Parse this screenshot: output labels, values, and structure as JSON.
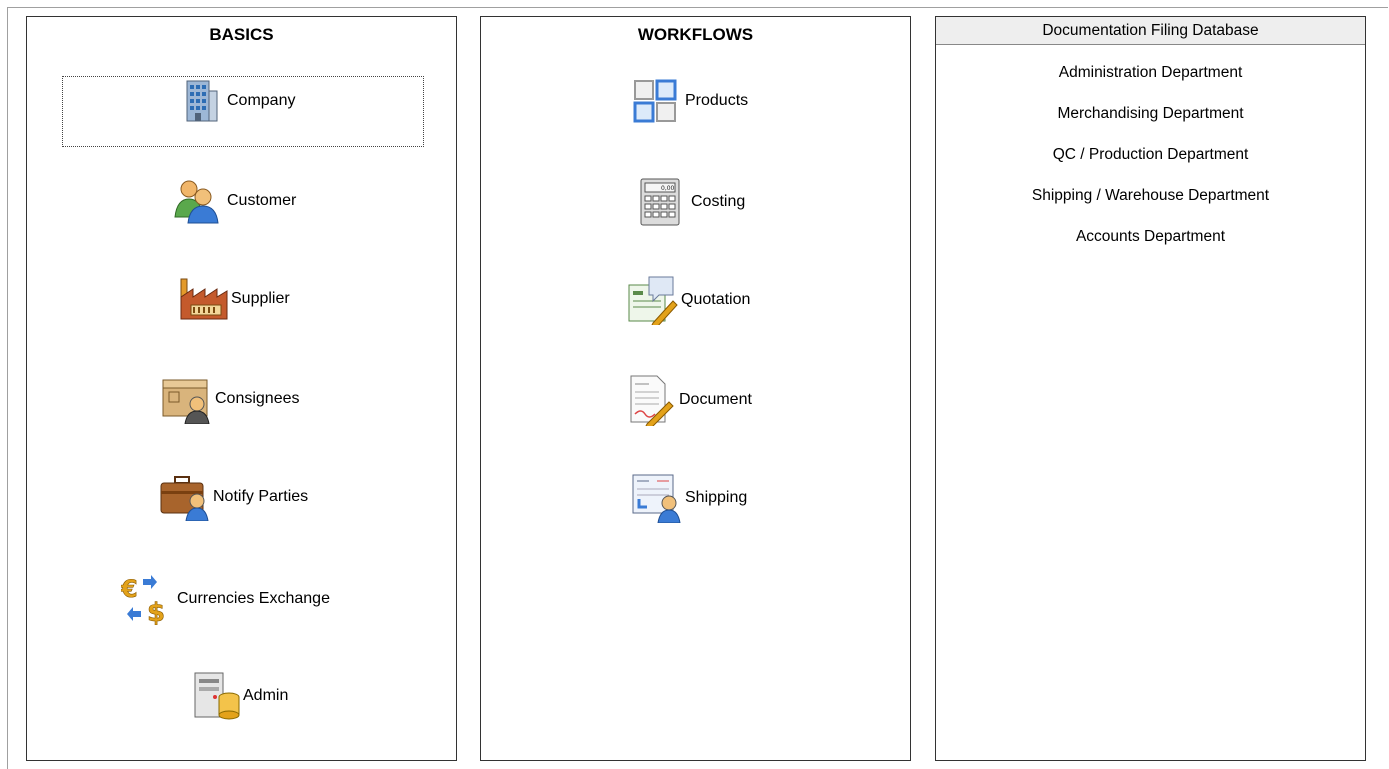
{
  "basics": {
    "title": "BASICS",
    "items": [
      {
        "label": "Company",
        "icon": "office-building-icon"
      },
      {
        "label": "Customer",
        "icon": "users-icon"
      },
      {
        "label": "Supplier",
        "icon": "factory-icon"
      },
      {
        "label": "Consignees",
        "icon": "box-person-icon"
      },
      {
        "label": "Notify Parties",
        "icon": "briefcase-person-icon"
      },
      {
        "label": "Currencies Exchange",
        "icon": "currency-exchange-icon"
      },
      {
        "label": "Admin",
        "icon": "server-database-icon"
      }
    ]
  },
  "workflows": {
    "title": "WORKFLOWS",
    "items": [
      {
        "label": "Products",
        "icon": "grid-squares-icon"
      },
      {
        "label": "Costing",
        "icon": "calculator-icon"
      },
      {
        "label": "Quotation",
        "icon": "quotation-pen-icon"
      },
      {
        "label": "Document",
        "icon": "document-pen-icon"
      },
      {
        "label": "Shipping",
        "icon": "invoice-person-icon"
      }
    ]
  },
  "docs": {
    "title": "Documentation Filing Database",
    "items": [
      "Administration Department",
      "Merchandising Department",
      "QC / Production Department",
      "Shipping / Warehouse Department",
      "Accounts Department"
    ]
  },
  "colors": {
    "panel_border": "#333333",
    "header_bg": "#eeeeee",
    "accent_blue": "#3a7bd5",
    "accent_orange": "#e39a2b"
  }
}
